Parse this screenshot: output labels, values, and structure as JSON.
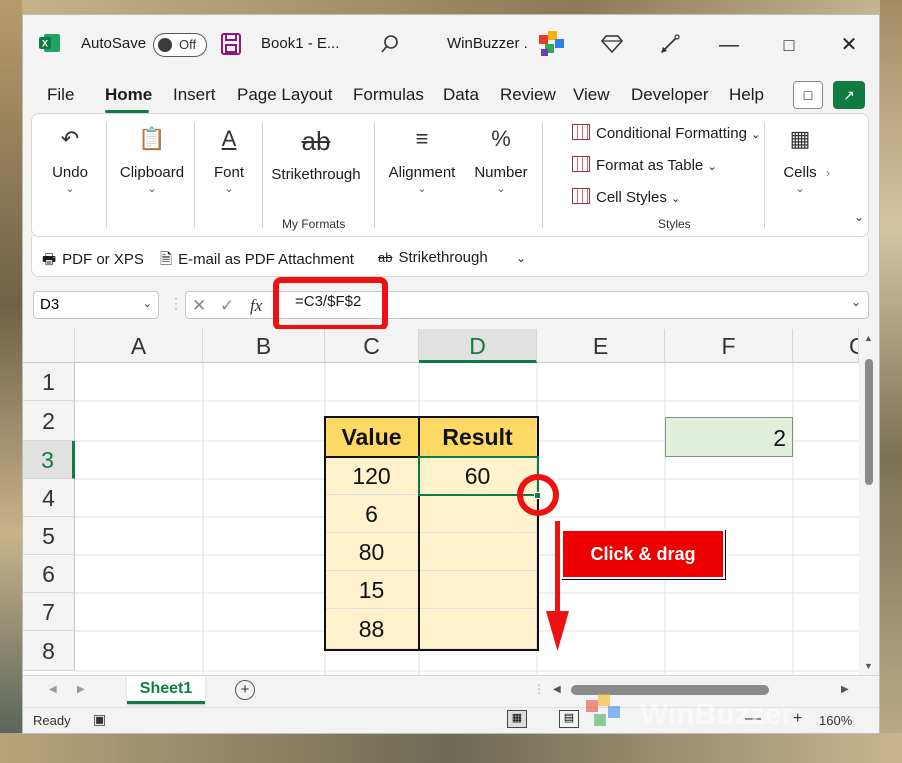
{
  "titlebar": {
    "autosave_label": "AutoSave",
    "autosave_state": "Off",
    "doc_name": "Book1  -  E...",
    "account": "WinBuzzer ."
  },
  "menu": {
    "items": [
      "File",
      "Home",
      "Insert",
      "Page Layout",
      "Formulas",
      "Data",
      "Review",
      "View",
      "Developer",
      "Help"
    ],
    "active": "Home"
  },
  "ribbon": {
    "groups": [
      {
        "label": "Undo"
      },
      {
        "label": "Clipboard"
      },
      {
        "label": "Font"
      },
      {
        "label": "Strikethrough"
      },
      {
        "label": "Alignment"
      },
      {
        "label": "Number"
      },
      {
        "label": "Cells"
      }
    ],
    "my_formats_title": "My Formats",
    "styles": {
      "conditional": "Conditional Formatting",
      "format_table": "Format as Table",
      "cell_styles": "Cell Styles",
      "title": "Styles"
    }
  },
  "qat": {
    "pdf": "PDF or XPS",
    "email_pdf": "E-mail as PDF Attachment",
    "strikethrough": "Strikethrough"
  },
  "formula_bar": {
    "name_box": "D3",
    "fx": "fx",
    "formula": "=C3/$F$2"
  },
  "grid": {
    "columns": [
      "A",
      "B",
      "C",
      "D",
      "E",
      "F",
      "G"
    ],
    "rows": [
      "1",
      "2",
      "3",
      "4",
      "5",
      "6",
      "7",
      "8"
    ],
    "header_value": "Value",
    "header_result": "Result",
    "values": [
      "120",
      "6",
      "80",
      "15",
      "88"
    ],
    "result_d3": "60",
    "f2": "2",
    "selected_column": "D",
    "selected_row": "3"
  },
  "callout": {
    "text": "Click & drag"
  },
  "sheets": {
    "active": "Sheet1"
  },
  "status": {
    "ready": "Ready",
    "zoom": "160%"
  },
  "colors": {
    "accent": "#107c41",
    "highlight": "#e11",
    "header_fill": "#ffd966",
    "value_fill": "#fff2cc",
    "param_fill": "#e2efda"
  }
}
